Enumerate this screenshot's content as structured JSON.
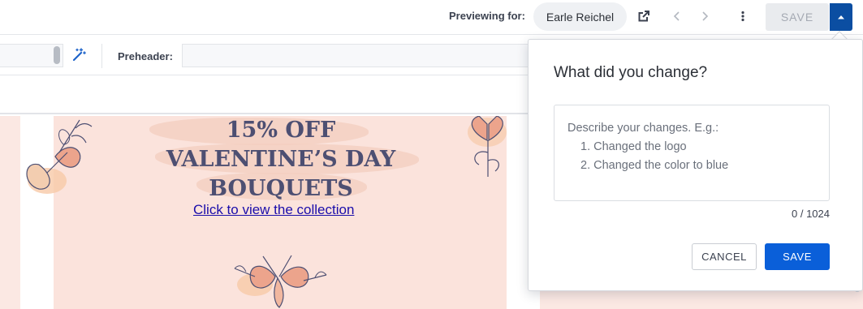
{
  "toolbar": {
    "previewing_label": "Previewing for:",
    "preview_user": "Earle Reichel",
    "save_label": "SAVE",
    "icons": [
      "external-link-icon",
      "chevron-left-icon",
      "chevron-right-icon",
      "more-vertical-icon",
      "caret-up-icon"
    ]
  },
  "editor": {
    "preheader_label": "Preheader:",
    "preheader_value": ""
  },
  "email": {
    "headline_line1": "15% OFF",
    "headline_line2": "VALENTINE’S DAY",
    "headline_line3": "BOUQUETS",
    "cta_link": "Click to view the collection"
  },
  "popover": {
    "title": "What did you change?",
    "placeholder_line1": "Describe your changes. E.g.:",
    "placeholder_line2": "1. Changed the logo",
    "placeholder_line3": "2. Changed the color to blue",
    "char_count": "0 / 1024",
    "cancel_label": "CANCEL",
    "save_label": "SAVE"
  },
  "colors": {
    "accent": "#0a5fd9",
    "save_caret_bg": "#0b4ea2",
    "email_bg": "#fbe3dc",
    "headline": "#4d4f72",
    "link": "#1a0dab"
  }
}
